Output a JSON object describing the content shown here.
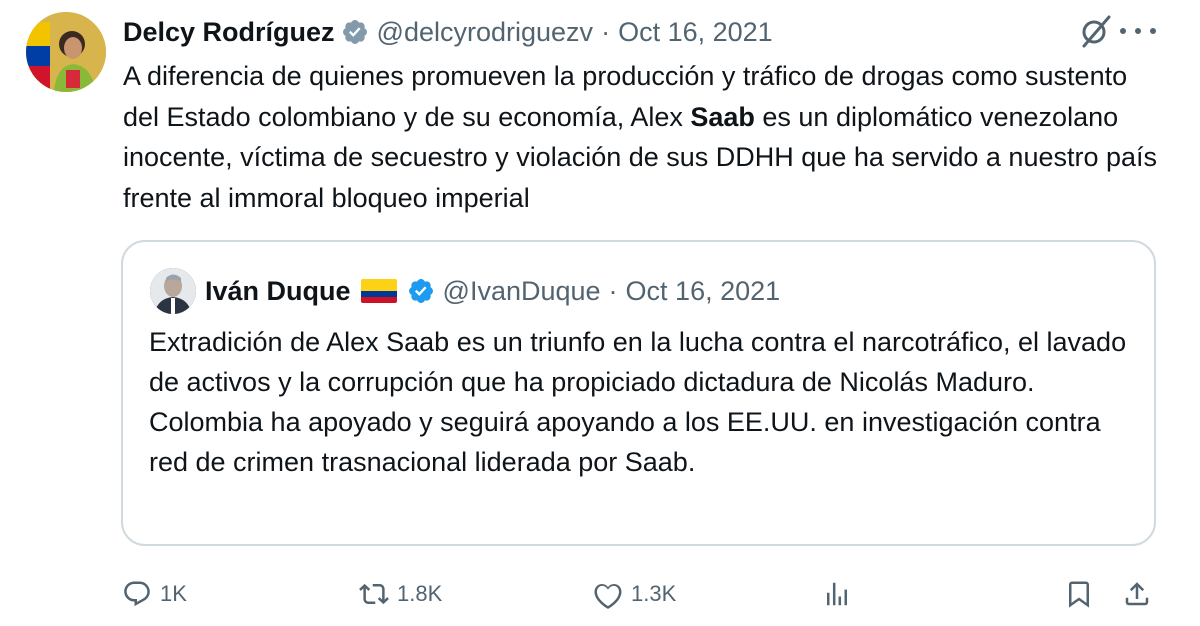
{
  "tweet": {
    "author_name": "Delcy Rodríguez",
    "handle": "@delcyrodriguezv",
    "separator": "·",
    "date": "Oct 16, 2021",
    "text_before_bold": "A diferencia de quienes promueven la producción y tráfico de drogas como sustento del Estado colombiano y de su economía, Alex ",
    "text_bold": "Saab",
    "text_after_bold": " es un diplomático venezolano inocente, víctima de secuestro y violación de sus DDHH que ha servido a nuestro país frente al immoral bloqueo imperial"
  },
  "quote": {
    "author_name": "Iván Duque",
    "handle": "@IvanDuque",
    "separator": "·",
    "date": "Oct 16, 2021",
    "text": "Extradición de Alex Saab es un triunfo en la lucha contra el narcotráfico, el lavado de activos y la corrupción que ha propiciado dictadura de Nicolás Maduro. Colombia ha apoyado y seguirá apoyando a los EE.UU. en investigación contra red de crimen trasnacional liderada por Saab."
  },
  "actions": {
    "replies": "1K",
    "reposts": "1.8K",
    "likes": "1.3K"
  },
  "colors": {
    "text_primary": "#0f1419",
    "text_secondary": "#536471",
    "verified_gold": "#829aab",
    "verified_blue": "#1d9bf0",
    "border": "#cfd9de"
  },
  "icons": [
    "verified-badge-icon",
    "grok-icon",
    "more-icon",
    "reply-icon",
    "retweet-icon",
    "like-icon",
    "views-icon",
    "bookmark-icon",
    "share-icon"
  ]
}
